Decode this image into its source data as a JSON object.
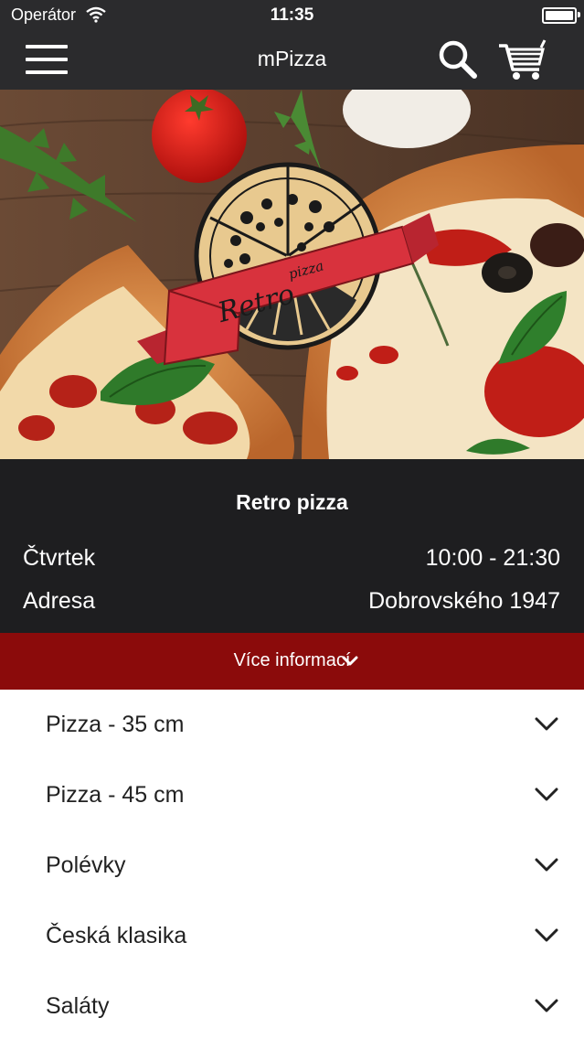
{
  "status_bar": {
    "carrier": "Operátor",
    "time": "11:35",
    "wifi_icon": "wifi-icon",
    "battery_icon": "battery-icon"
  },
  "navbar": {
    "title": "mPizza",
    "menu_icon": "hamburger-menu-icon",
    "search_icon": "search-icon",
    "cart_icon": "cart-icon"
  },
  "hero": {
    "logo_text": "Retro pizza"
  },
  "restaurant": {
    "name": "Retro pizza",
    "hours_label": "Čtvrtek",
    "hours_value": "10:00 - 21:30",
    "address_label": "Adresa",
    "address_value": "Dobrovského 1947"
  },
  "more_info": {
    "label": "Více informací"
  },
  "categories": [
    {
      "label": "Pizza - 35 cm"
    },
    {
      "label": "Pizza - 45 cm"
    },
    {
      "label": "Polévky"
    },
    {
      "label": "Česká klasika"
    },
    {
      "label": "Saláty"
    }
  ],
  "colors": {
    "navbar_bg": "#2b2b2d",
    "info_bg": "#1e1e20",
    "accent_red": "#8b0b0b",
    "ribbon_red": "#d8323d"
  }
}
